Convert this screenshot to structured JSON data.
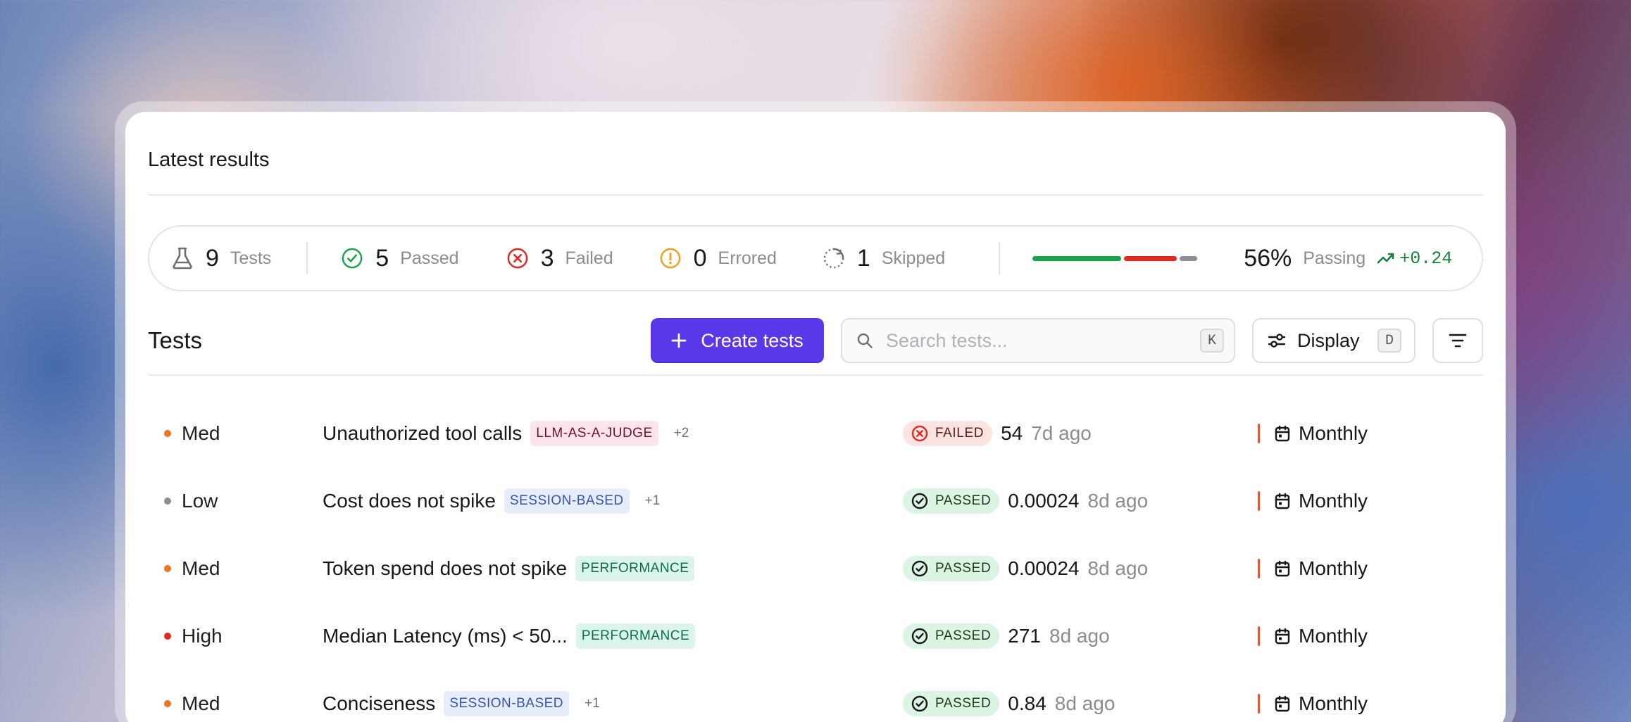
{
  "card": {
    "title": "Latest results"
  },
  "summary": {
    "tests": {
      "count": "9",
      "label": "Tests"
    },
    "passed": {
      "count": "5",
      "label": "Passed"
    },
    "failed": {
      "count": "3",
      "label": "Failed"
    },
    "errored": {
      "count": "0",
      "label": "Errored"
    },
    "skipped": {
      "count": "1",
      "label": "Skipped"
    },
    "passing_pct": "56%",
    "passing_label": "Passing",
    "delta": "+0.24",
    "bar_segments": [
      {
        "name": "passed",
        "count": 5,
        "color": "#1aa34a"
      },
      {
        "name": "failed",
        "count": 3,
        "color": "#e02a20"
      },
      {
        "name": "skipped",
        "count": 1,
        "color": "#8e8e98"
      }
    ]
  },
  "toolbar": {
    "title": "Tests",
    "create_label": "Create tests",
    "search_placeholder": "Search tests...",
    "search_shortcut": "K",
    "display_label": "Display",
    "display_shortcut": "D"
  },
  "colors": {
    "accent": "#5b37ea",
    "priority_med": "#f07422",
    "priority_low": "#8e8e98",
    "priority_high": "#e02a20"
  },
  "rows": [
    {
      "priority": "Med",
      "priority_color": "#f07422",
      "name": "Unauthorized tool calls",
      "tag": "LLM-AS-A-JUDGE",
      "tag_style": "pink",
      "more": "+2",
      "status": "FAILED",
      "value": "54",
      "ago": "7d ago",
      "schedule": "Monthly"
    },
    {
      "priority": "Low",
      "priority_color": "#8e8e98",
      "name": "Cost does not spike",
      "tag": "SESSION-BASED",
      "tag_style": "blue",
      "more": "+1",
      "status": "PASSED",
      "value": "0.00024",
      "ago": "8d ago",
      "schedule": "Monthly"
    },
    {
      "priority": "Med",
      "priority_color": "#f07422",
      "name": "Token spend does not spike",
      "tag": "PERFORMANCE",
      "tag_style": "green",
      "more": "",
      "status": "PASSED",
      "value": "0.00024",
      "ago": "8d ago",
      "schedule": "Monthly"
    },
    {
      "priority": "High",
      "priority_color": "#e02a20",
      "name": "Median Latency (ms) < 50...",
      "tag": "PERFORMANCE",
      "tag_style": "green",
      "more": "",
      "status": "PASSED",
      "value": "271",
      "ago": "8d ago",
      "schedule": "Monthly"
    },
    {
      "priority": "Med",
      "priority_color": "#f07422",
      "name": "Conciseness",
      "tag": "SESSION-BASED",
      "tag_style": "blue",
      "more": "+1",
      "status": "PASSED",
      "value": "0.84",
      "ago": "8d ago",
      "schedule": "Monthly"
    }
  ]
}
